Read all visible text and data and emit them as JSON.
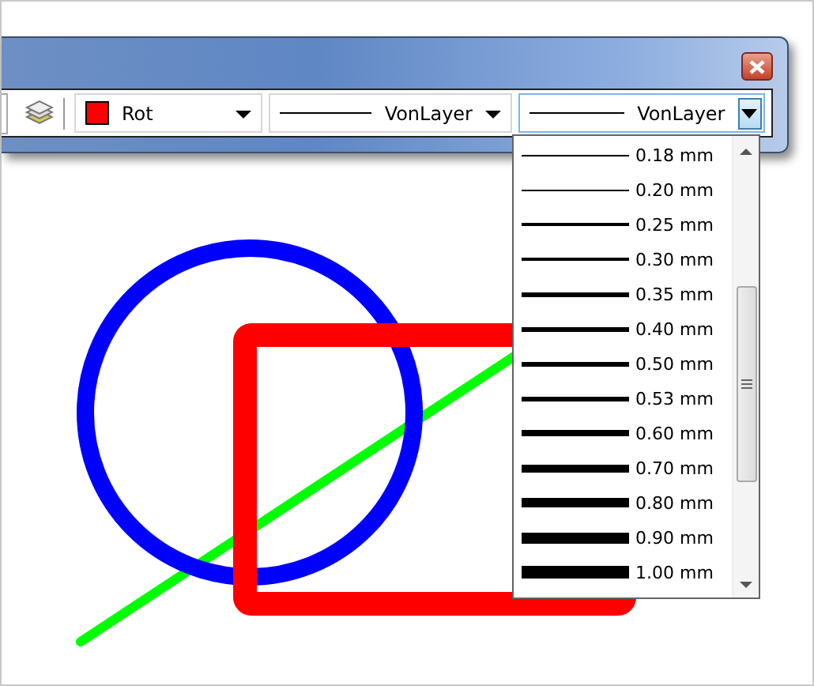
{
  "toolbar": {
    "color_combo": {
      "value": "Rot",
      "color": "#ff0000"
    },
    "linetype_combo": {
      "value": "VonLayer"
    },
    "lineweight_combo": {
      "value": "VonLayer",
      "expanded": true
    }
  },
  "lineweight_list": {
    "items": [
      {
        "label": "0.18 mm"
      },
      {
        "label": "0.20 mm"
      },
      {
        "label": "0.25 mm"
      },
      {
        "label": "0.30 mm"
      },
      {
        "label": "0.35 mm"
      },
      {
        "label": "0.40 mm"
      },
      {
        "label": "0.50 mm"
      },
      {
        "label": "0.53 mm"
      },
      {
        "label": "0.60 mm"
      },
      {
        "label": "0.70 mm"
      },
      {
        "label": "0.80 mm"
      },
      {
        "label": "0.90 mm"
      },
      {
        "label": "1.00 mm"
      }
    ]
  }
}
